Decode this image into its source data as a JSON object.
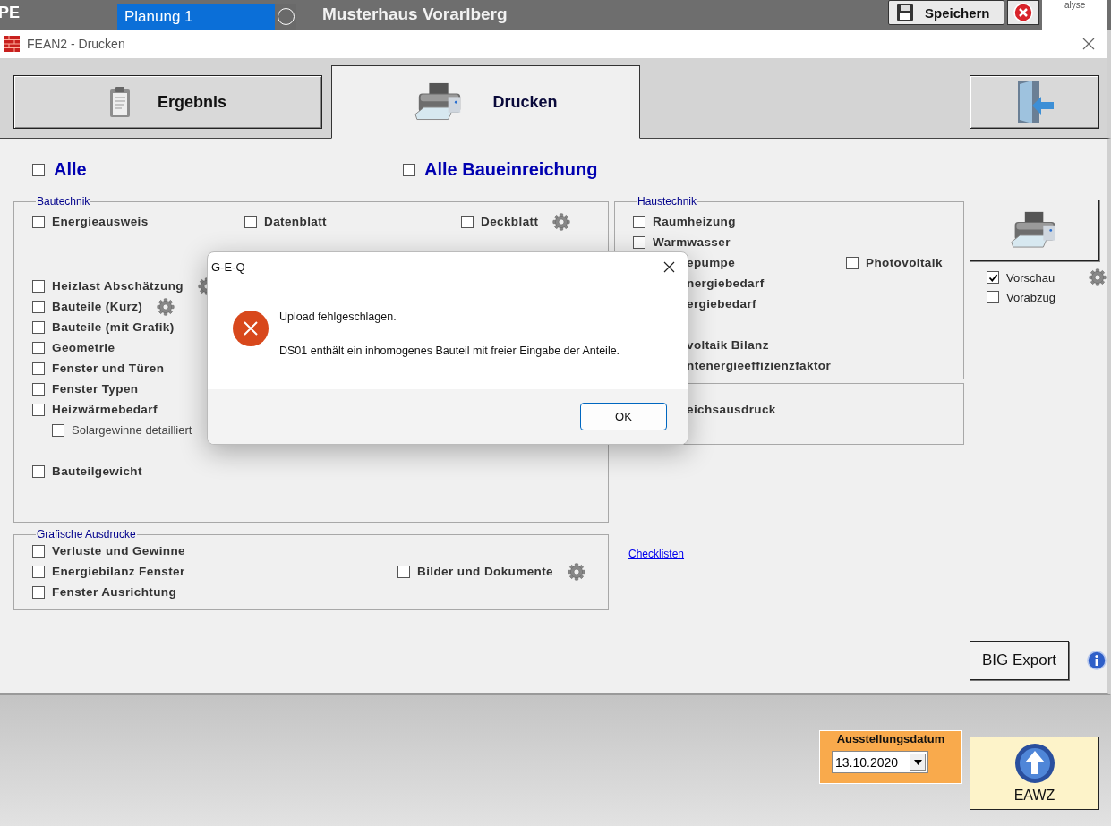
{
  "top_bar": {
    "app_label": "PE",
    "plan_field": "Planung 1",
    "project_title": "Musterhaus Vorarlberg",
    "save_button": "Speichern",
    "corner_text": "alyse"
  },
  "window": {
    "title": "FEAN2 - Drucken"
  },
  "tabs": [
    {
      "label": "Ergebnis",
      "selected": false
    },
    {
      "label": "Drucken",
      "selected": true
    }
  ],
  "select_all": [
    {
      "label": "Alle",
      "checked": false
    },
    {
      "label": "Alle Baueinreichung",
      "checked": false
    }
  ],
  "bautechnik": {
    "legend": "Bautechnik",
    "sections": [
      {
        "rows": [
          [
            {
              "kind": "checkbox",
              "label": "Energieausweis",
              "checked": false
            },
            {
              "kind": "checkbox",
              "label": "Datenblatt",
              "checked": false
            },
            {
              "kind": "checkbox",
              "label": "Deckblatt",
              "checked": false,
              "settings": true
            }
          ]
        ]
      },
      {
        "rows": [
          [
            {
              "kind": "checkbox",
              "label": "Heizlast Abschätzung",
              "checked": false,
              "settings": true
            }
          ],
          [
            {
              "kind": "checkbox",
              "label": "Bauteile (Kurz)",
              "checked": false,
              "settings": true
            }
          ],
          [
            {
              "kind": "checkbox",
              "label": "Bauteile (mit Grafik)",
              "checked": false
            }
          ],
          [
            {
              "kind": "checkbox",
              "label": "Geometrie",
              "checked": false
            }
          ],
          [
            {
              "kind": "checkbox",
              "label": "Fenster und Türen",
              "checked": false
            }
          ],
          [
            {
              "kind": "checkbox",
              "label": "Fenster Typen",
              "checked": false
            }
          ],
          [
            {
              "kind": "checkbox",
              "label": "Heizwärmebedarf",
              "checked": false
            }
          ],
          [
            {
              "kind": "sub",
              "label": "Solargewinne detailliert",
              "checked": false
            }
          ]
        ]
      },
      {
        "rows": [
          [
            {
              "kind": "checkbox",
              "label": "Bauteilgewicht",
              "checked": false
            }
          ]
        ]
      }
    ]
  },
  "grafische_ausdrucke": {
    "legend": "Grafische Ausdrucke",
    "rows": [
      [
        {
          "kind": "checkbox",
          "label": "Verluste und Gewinne",
          "checked": false
        }
      ],
      [
        {
          "kind": "checkbox",
          "label": "Energiebilanz Fenster",
          "checked": false
        },
        {
          "kind": "checkbox",
          "label": "Bilder und Dokumente",
          "checked": false,
          "settings": true
        }
      ],
      [
        {
          "kind": "checkbox",
          "label": "Fenster Ausrichtung",
          "checked": false
        }
      ]
    ]
  },
  "haustechnik": {
    "legend": "Haustechnik",
    "sections": [
      {
        "rows": [
          [
            {
              "kind": "checkbox",
              "label": "Raumheizung",
              "checked": false
            }
          ],
          [
            {
              "kind": "checkbox",
              "label": "Warmwasser",
              "checked": false
            }
          ],
          [
            {
              "kind": "covered",
              "label": "epumpe"
            },
            {
              "kind": "checkbox",
              "label": "Photovoltaik",
              "checked": false
            }
          ],
          [
            {
              "kind": "covered",
              "label": "nergiebedarf"
            }
          ],
          [
            {
              "kind": "covered",
              "label": "ergiebedarf"
            }
          ]
        ]
      },
      {
        "rows": [
          [
            {
              "kind": "covered",
              "label": "voltaik Bilanz"
            }
          ],
          [
            {
              "kind": "covered",
              "label": "ntenergieeffizienzfaktor"
            }
          ]
        ]
      }
    ]
  },
  "summary_box": {
    "rows": [
      [
        {
          "kind": "covered",
          "label": "eichsausdruck"
        }
      ]
    ]
  },
  "checklists_link": "Checklisten",
  "print_options": [
    {
      "label": "Vorschau",
      "checked": true,
      "settings": true
    },
    {
      "label": "Vorabzug",
      "checked": false
    }
  ],
  "big_export_button": "BIG Export",
  "issue_date": {
    "label": "Ausstellungsdatum",
    "value": "13.10.2020"
  },
  "eawz_button": "EAWZ",
  "dialog": {
    "title": "G-E-Q",
    "message": "Upload fehlgeschlagen.",
    "detail": "DS01 enthält ein inhomogenes Bauteil mit freier Eingabe der Anteile.",
    "button": "OK"
  }
}
